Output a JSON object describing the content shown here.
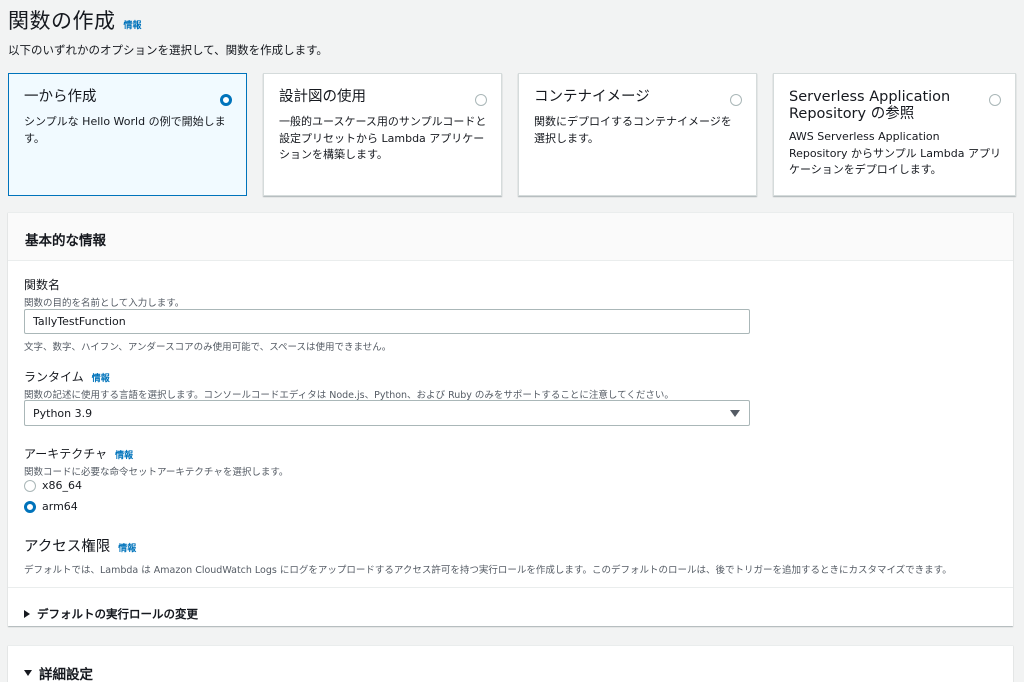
{
  "header": {
    "title": "関数の作成",
    "info_link": "情報",
    "description": "以下のいずれかのオプションを選択して、関数を作成します。"
  },
  "tiles": [
    {
      "title": "一から作成",
      "description": "シンプルな Hello World の例で開始します。",
      "selected": true
    },
    {
      "title": "設計図の使用",
      "description": "一般的ユースケース用のサンプルコードと設定プリセットから Lambda アプリケーションを構築します。",
      "selected": false
    },
    {
      "title": "コンテナイメージ",
      "description": "関数にデプロイするコンテナイメージを選択します。",
      "selected": false
    },
    {
      "title": "Serverless Application Repository の参照",
      "description": "AWS Serverless Application Repository からサンプル Lambda アプリケーションをデプロイします。",
      "selected": false
    }
  ],
  "basic": {
    "header": "基本的な情報",
    "function_name": {
      "label": "関数名",
      "description": "関数の目的を名前として入力します。",
      "value": "TallyTestFunction",
      "constraint": "文字、数字、ハイフン、アンダースコアのみ使用可能で、スペースは使用できません。"
    },
    "runtime": {
      "label": "ランタイム",
      "info_link": "情報",
      "description": "関数の記述に使用する言語を選択します。コンソールコードエディタは Node.js、Python、および Ruby のみをサポートすることに注意してください。",
      "selected": "Python 3.9"
    },
    "architecture": {
      "label": "アーキテクチャ",
      "info_link": "情報",
      "description": "関数コードに必要な命令セットアーキテクチャを選択します。",
      "options": [
        {
          "label": "x86_64",
          "checked": false
        },
        {
          "label": "arm64",
          "checked": true
        }
      ]
    },
    "permissions": {
      "title": "アクセス権限",
      "info_link": "情報",
      "description": "デフォルトでは、Lambda は Amazon CloudWatch Logs にログをアップロードするアクセス許可を持つ実行ロールを作成します。このデフォルトのロールは、後でトリガーを追加するときにカスタマイズできます。",
      "expand_label": "デフォルトの実行ロールの変更"
    }
  },
  "advanced": {
    "label": "詳細設定"
  },
  "colors": {
    "accent": "#0073bb",
    "selected_tile_bg": "#f1faff",
    "page_bg": "#f2f3f3"
  }
}
